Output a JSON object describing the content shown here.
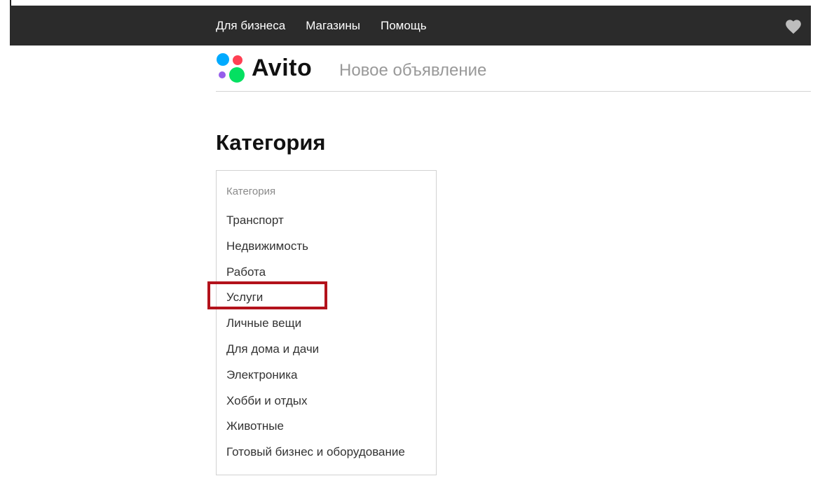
{
  "topbar": {
    "links": [
      "Для бизнеса",
      "Магазины",
      "Помощь"
    ],
    "favorites_icon": "heart-icon"
  },
  "header": {
    "logo_text": "Avito",
    "logo_dot_colors": [
      "#0af",
      "#ff4053",
      "#965eeb",
      "#04e061"
    ],
    "title": "Новое объявление"
  },
  "page": {
    "title": "Категория"
  },
  "category_select": {
    "label": "Категория",
    "items": [
      "Транспорт",
      "Недвижимость",
      "Работа",
      "Услуги",
      "Личные вещи",
      "Для дома и дачи",
      "Электроника",
      "Хобби и отдых",
      "Животные",
      "Готовый бизнес и оборудование"
    ],
    "highlighted_item": "Услуги",
    "highlight_color": "#b3121b"
  }
}
